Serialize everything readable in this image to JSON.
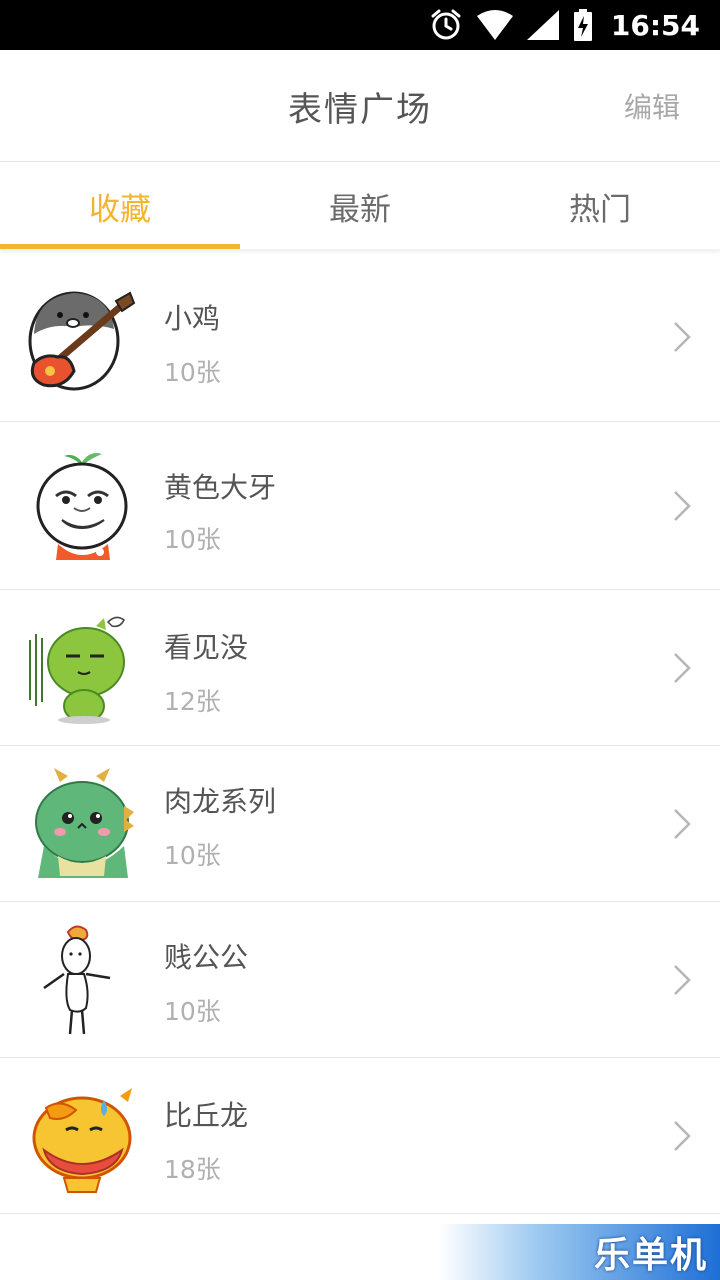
{
  "status_bar": {
    "time": "16:54",
    "icons": [
      "alarm-icon",
      "wifi-icon",
      "signal-icon",
      "battery-charging-icon"
    ]
  },
  "header": {
    "title": "表情广场",
    "edit_label": "编辑"
  },
  "tabs": [
    {
      "label": "收藏",
      "active": true
    },
    {
      "label": "最新",
      "active": false
    },
    {
      "label": "热门",
      "active": false
    }
  ],
  "colors": {
    "accent": "#f3b42f",
    "text_primary": "#555555",
    "text_secondary": "#b0b0b0",
    "divider": "#e6e6e6"
  },
  "sticker_packs": [
    {
      "name": "小鸡",
      "count": "10张",
      "icon": "chick-guitar-sticker"
    },
    {
      "name": "黄色大牙",
      "count": "10张",
      "icon": "rage-face-sprout-sticker"
    },
    {
      "name": "看见没",
      "count": "12张",
      "icon": "green-blob-sticker"
    },
    {
      "name": "肉龙系列",
      "count": "10张",
      "icon": "green-dragon-sticker"
    },
    {
      "name": "贱公公",
      "count": "10张",
      "icon": "stick-figure-sticker"
    },
    {
      "name": "比丘龙",
      "count": "18张",
      "icon": "yellow-dragon-sticker"
    }
  ],
  "watermark": "乐单机"
}
